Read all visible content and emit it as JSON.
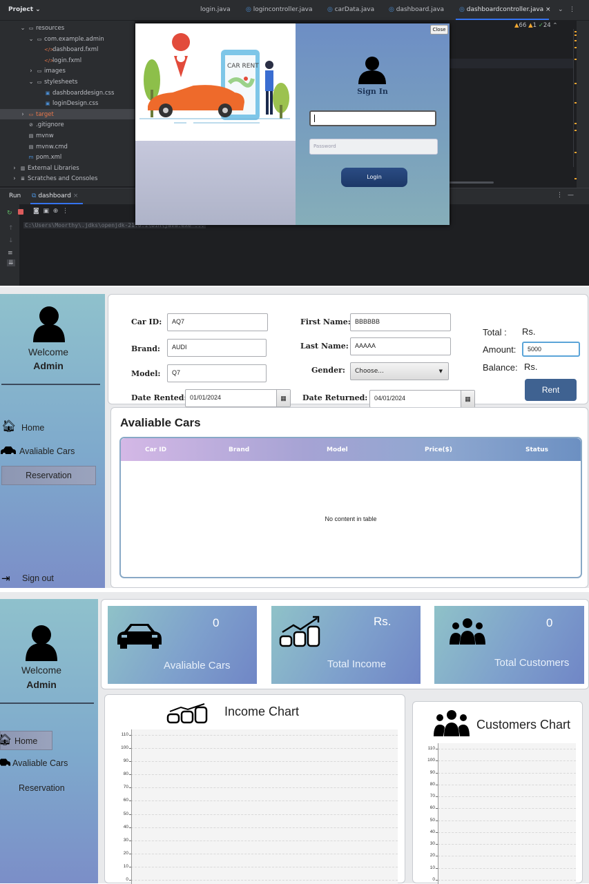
{
  "ide": {
    "project_label": "Project ⌄",
    "editor_tabs": [
      {
        "label": "login.java"
      },
      {
        "label": "logincontroller.java"
      },
      {
        "label": "carData.java"
      },
      {
        "label": "dashboard.java"
      },
      {
        "label": "dashboardcontroller.java",
        "active": true
      }
    ],
    "tree": [
      {
        "label": "resources",
        "icon": "folder-icon",
        "indent": 1,
        "expanded": true
      },
      {
        "label": "com.example.admin",
        "icon": "folder-icon",
        "indent": 2,
        "expanded": true
      },
      {
        "label": "dashboard.fxml",
        "icon": "fxml-file-icon",
        "indent": 3
      },
      {
        "label": "login.fxml",
        "icon": "fxml-file-icon",
        "indent": 3
      },
      {
        "label": "images",
        "icon": "folder-icon",
        "indent": 2
      },
      {
        "label": "stylesheets",
        "icon": "folder-icon",
        "indent": 2,
        "expanded": true
      },
      {
        "label": "dashboarddesign.css",
        "icon": "css-file-icon",
        "indent": 3
      },
      {
        "label": "loginDesign.css",
        "icon": "css-file-icon",
        "indent": 3
      },
      {
        "label": "target",
        "icon": "folder-icon",
        "indent": 1,
        "selected": true
      },
      {
        "label": ".gitignore",
        "icon": "gitignore-icon",
        "indent": 1
      },
      {
        "label": "mvnw",
        "icon": "file-icon",
        "indent": 1
      },
      {
        "label": "mvnw.cmd",
        "icon": "file-icon",
        "indent": 1
      },
      {
        "label": "pom.xml",
        "icon": "maven-icon",
        "indent": 1
      },
      {
        "label": "External Libraries",
        "icon": "library-icon",
        "indent": 0
      },
      {
        "label": "Scratches and Consoles",
        "icon": "scratch-icon",
        "indent": 0
      }
    ],
    "inspection": {
      "warnings": "66",
      "weak_warnings": "1",
      "ok": "24"
    },
    "run_label": "Run",
    "run_tab": "dashboard",
    "console_cmd": "C:\\Users\\Moorthy\\.jdks\\openjdk-21.0.1\\bin\\java.exe ..."
  },
  "login_dialog": {
    "close_label": "Close",
    "illustration_text": "CAR RENT",
    "signin_title": "Sign In",
    "username_value": "",
    "password_placeholder": "Password",
    "login_label": "Login"
  },
  "reservation": {
    "sidebar": {
      "welcome": "Welcome",
      "admin": "Admin",
      "nav": {
        "home": "Home",
        "cars": "Avaliable Cars",
        "reservation": "Reservation",
        "signout": "Sign out"
      }
    },
    "form": {
      "car_id_label": "Car ID:",
      "car_id": "AQ7",
      "brand_label": "Brand:",
      "brand": "AUDI",
      "model_label": "Model:",
      "model": "Q7",
      "first_name_label": "First Name:",
      "first_name": "BBBBBB",
      "last_name_label": "Last Name:",
      "last_name": "AAAAA",
      "gender_label": "Gender:",
      "gender": "Choose...",
      "date_rented_label": "Date Rented:",
      "date_rented": "01/01/2024",
      "date_returned_label": "Date Returned:",
      "date_returned": "04/01/2024",
      "total_label": "Total :",
      "total_value": "Rs.",
      "amount_label": "Amount:",
      "amount": "5000",
      "balance_label": "Balance:",
      "balance_value": "Rs.",
      "rent_label": "Rent"
    },
    "table": {
      "title": "Avaliable Cars",
      "columns": [
        "Car ID",
        "Brand",
        "Model",
        "Price($)",
        "Status"
      ],
      "empty_text": "No content in table"
    }
  },
  "dashboard": {
    "sidebar": {
      "welcome": "Welcome",
      "admin": "Admin",
      "nav": {
        "home": "Home",
        "cars": "Avaliable Cars",
        "reservation": "Reservation"
      }
    },
    "stats": [
      {
        "value": "0",
        "label": "Avaliable Cars",
        "icon": "car-icon"
      },
      {
        "value": "Rs.",
        "label": "Total Income",
        "icon": "income-icon"
      },
      {
        "value": "0",
        "label": "Total Customers",
        "icon": "users-icon"
      }
    ]
  },
  "chart_data": [
    {
      "type": "line",
      "title": "Income Chart",
      "yticks": [
        "0",
        "10",
        "20",
        "30",
        "40",
        "50",
        "60",
        "70",
        "80",
        "90",
        "100",
        "110"
      ],
      "ylim": [
        0,
        110
      ],
      "grid": true,
      "series": []
    },
    {
      "type": "line",
      "title": "Customers Chart",
      "yticks": [
        "0",
        "10",
        "20",
        "30",
        "40",
        "50",
        "60",
        "70",
        "80",
        "90",
        "100",
        "110"
      ],
      "ylim": [
        0,
        110
      ],
      "grid": true,
      "series": []
    }
  ]
}
